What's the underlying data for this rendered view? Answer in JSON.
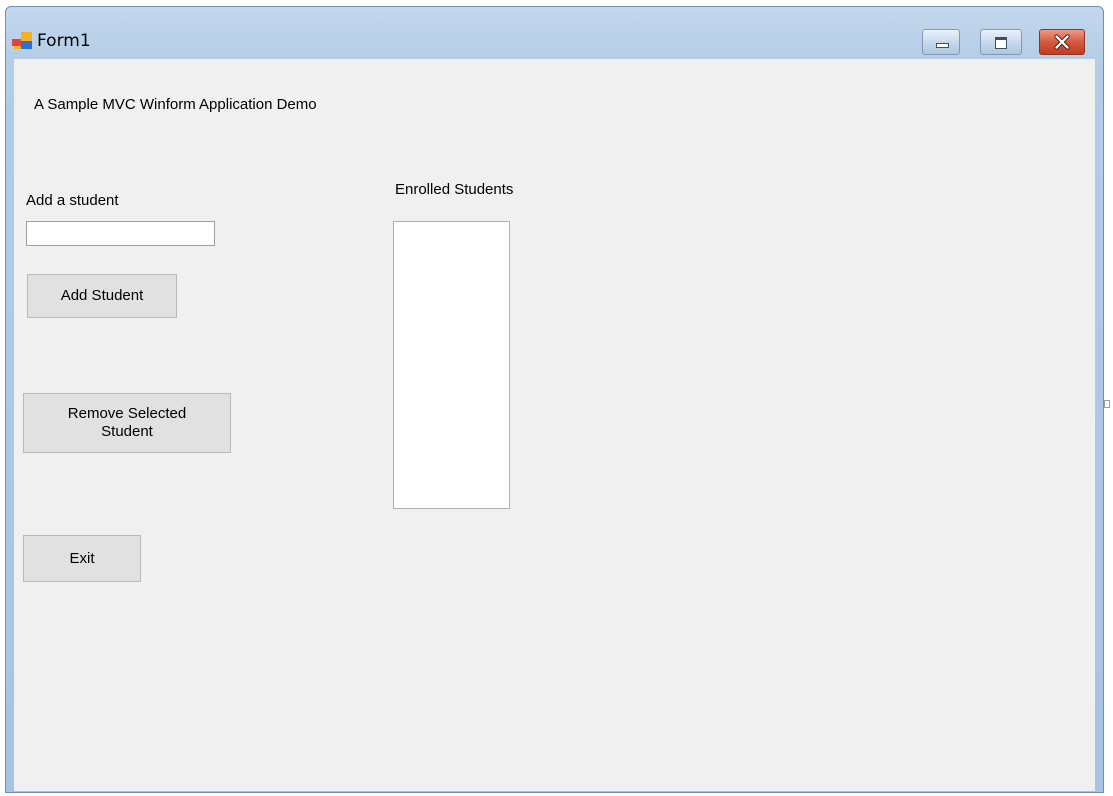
{
  "window": {
    "title": "Form1"
  },
  "form": {
    "header_text": "A Sample MVC Winform Application Demo",
    "add_label": "Add a student",
    "student_name_input": {
      "value": "",
      "placeholder": ""
    },
    "add_button": "Add Student",
    "remove_button_line1": "Remove Selected",
    "remove_button_line2": "Student",
    "exit_button": "Exit",
    "enrolled_label": "Enrolled Students",
    "enrolled_students": []
  },
  "colors": {
    "form_background": "#f0f0f0",
    "button_face": "#e1e1e1",
    "close_button": "#c94a30",
    "titlebar": "#b4cce6"
  }
}
